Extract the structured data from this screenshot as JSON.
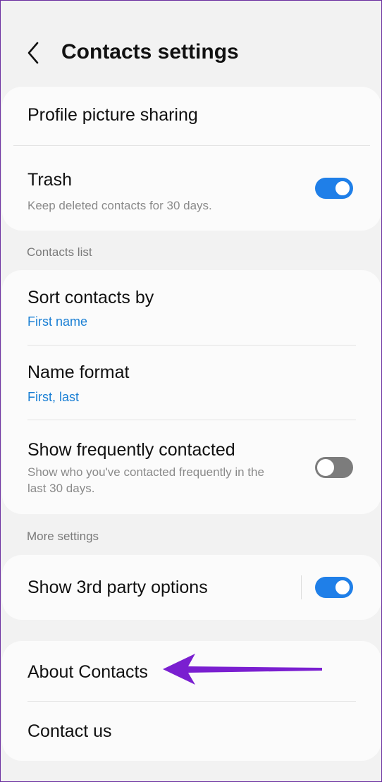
{
  "header": {
    "title": "Contacts settings"
  },
  "card1": {
    "profile_label": "Profile picture sharing",
    "trash_title": "Trash",
    "trash_sub": "Keep deleted contacts for 30 days.",
    "trash_enabled": true
  },
  "sections": {
    "contacts_list": "Contacts list",
    "more_settings": "More settings"
  },
  "card2": {
    "sort_title": "Sort contacts by",
    "sort_value": "First name",
    "name_title": "Name format",
    "name_value": "First, last",
    "freq_title": "Show frequently contacted",
    "freq_sub_line1": "Show who you've contacted frequently in the",
    "freq_sub_line2": "last 30 days.",
    "freq_enabled": false
  },
  "card3": {
    "third_party_title": "Show 3rd party options",
    "third_party_enabled": true
  },
  "card4": {
    "about": "About Contacts",
    "contact_us": "Contact us"
  },
  "colors": {
    "accent": "#1f7fe8",
    "link": "#1a7fd4",
    "annotation_arrow": "#7a1fd0"
  }
}
